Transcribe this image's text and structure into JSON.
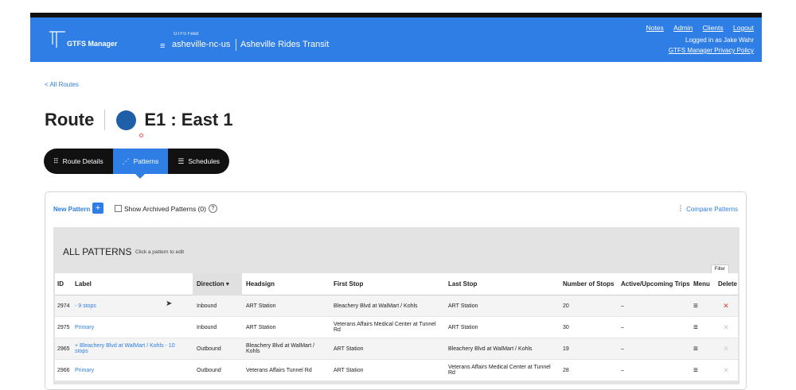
{
  "header": {
    "app_name": "GTFS Manager",
    "feed_caption": "GTFS Feed",
    "feed_id": "asheville-nc-us",
    "feed_name": "Asheville Rides Transit",
    "links": [
      "Notes",
      "Admin",
      "Clients",
      "Logout"
    ],
    "logged_in": "Logged in as Jake Wahr",
    "privacy": "GTFS Manager Privacy Policy",
    "brand_color": "#2e7ee6"
  },
  "back_link": "< All Routes",
  "route": {
    "word": "Route",
    "name": "E1 : East 1",
    "color": "#1f5fa8"
  },
  "tabs": [
    {
      "label": "Route Details",
      "icon": "grip-icon"
    },
    {
      "label": "Patterns",
      "icon": "pattern-icon",
      "active": true
    },
    {
      "label": "Schedules",
      "icon": "schedule-icon"
    }
  ],
  "panel": {
    "new_pattern": "New Pattern",
    "show_archived": "Show Archived Patterns (0)",
    "compare": "Compare Patterns",
    "all_patterns": "ALL PATTERNS",
    "hint": "Click a pattern to edit",
    "filter": "Filter"
  },
  "table": {
    "headers": {
      "id": "ID",
      "label": "Label",
      "direction": "Direction",
      "headsign": "Headsign",
      "first_stop": "First Stop",
      "last_stop": "Last Stop",
      "num_stops": "Number of Stops",
      "active": "Active/Upcoming Trips",
      "menu": "Menu",
      "delete": "Delete"
    },
    "rows": [
      {
        "id": "2974",
        "label": "- 9 stops",
        "direction": "Inbound",
        "headsign": "ART Station",
        "first_stop": "Bleachery Blvd at WalMart / Kohls",
        "last_stop": "ART Station",
        "num_stops": "20",
        "active": "–",
        "deletable": true
      },
      {
        "id": "2975",
        "label": "Primary",
        "direction": "Inbound",
        "headsign": "ART Station",
        "first_stop": "Veterans Affairs Medical Center at Tunnel Rd",
        "last_stop": "ART Station",
        "num_stops": "30",
        "active": "–",
        "deletable": false
      },
      {
        "id": "2965",
        "label": "+ Bleachery Blvd at WalMart / Kohls - 10 stops",
        "direction": "Outbound",
        "headsign": "Bleachery Blvd at WalMart / Kohls",
        "first_stop": "ART Station",
        "last_stop": "Bleachery Blvd at WalMart / Kohls",
        "num_stops": "19",
        "active": "–",
        "deletable": false
      },
      {
        "id": "2966",
        "label": "Primary",
        "direction": "Outbound",
        "headsign": "Veterans Affairs Tunnel Rd",
        "first_stop": "ART Station",
        "last_stop": "Veterans Affairs Medical Center at Tunnel Rd",
        "num_stops": "28",
        "active": "–",
        "deletable": false
      }
    ]
  }
}
